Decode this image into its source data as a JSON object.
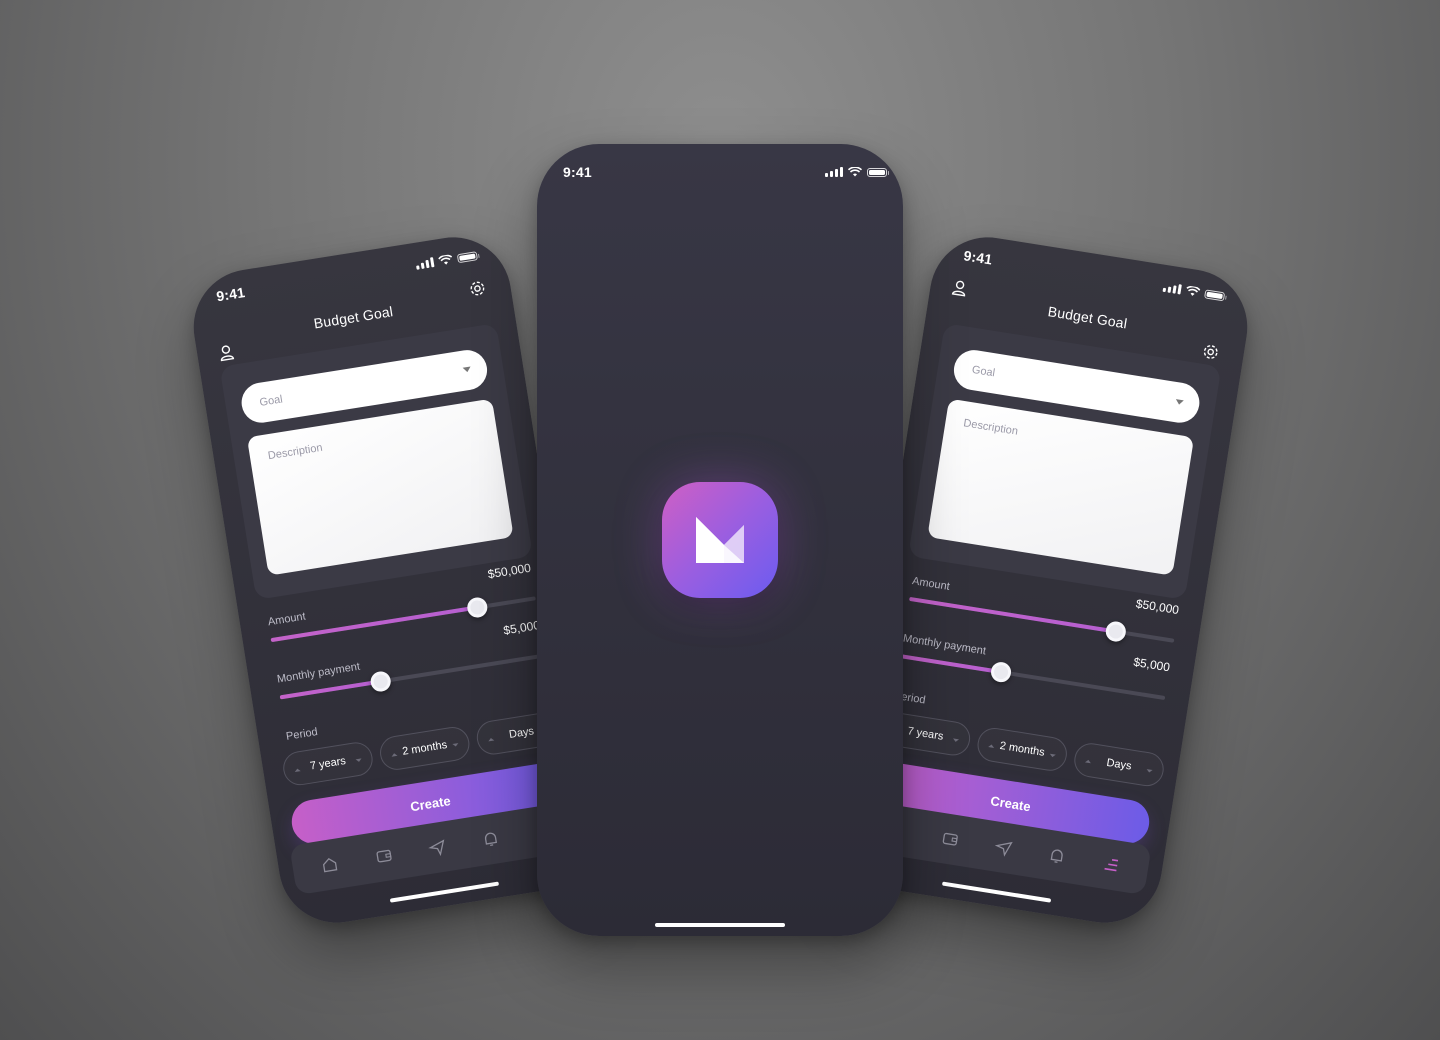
{
  "status": {
    "time": "9:41"
  },
  "form": {
    "title": "Budget Goal",
    "goal_placeholder": "Goal",
    "description_placeholder": "Description",
    "amount_label": "Amount",
    "amount_value": "$50,000",
    "amount_level": 0.78,
    "monthly_label": "Monthly payment",
    "monthly_value": "$5,000",
    "monthly_level": 0.38,
    "period_label": "Period",
    "period_years": "7 years",
    "period_months": "2 months",
    "period_days": "Days",
    "create_label": "Create"
  },
  "tabs": [
    "home-icon",
    "wallet-icon",
    "send-icon",
    "bell-icon",
    "menu-icon"
  ],
  "colors": {
    "accent_start": "#c65fc8",
    "accent_end": "#6c5ce7",
    "phone_bg": "#34333f"
  }
}
